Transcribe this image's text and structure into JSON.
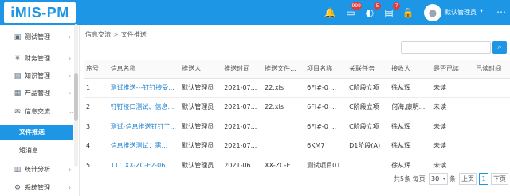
{
  "app": {
    "logo_text": "iMIS-PM"
  },
  "header": {
    "icons": [
      {
        "name": "bell-icon",
        "glyph": "🔔",
        "badge": ""
      },
      {
        "name": "message-icon",
        "glyph": "▭",
        "badge": "999"
      },
      {
        "name": "notice-icon",
        "glyph": "◐",
        "badge": "5"
      },
      {
        "name": "mail-icon",
        "glyph": "▤",
        "badge": "7"
      },
      {
        "name": "lock-icon",
        "glyph": "🔒",
        "badge": ""
      }
    ],
    "user_name": "默认管理员",
    "user_caret": "▾",
    "more_glyph": "⋯"
  },
  "sidebar": {
    "items": [
      {
        "label": "测试管理",
        "icon": "▣",
        "arrow": "›"
      },
      {
        "label": "财务管理",
        "icon": "¥",
        "arrow": "›"
      },
      {
        "label": "知识管理",
        "icon": "▤",
        "arrow": "›"
      },
      {
        "label": "产品管理",
        "icon": "▦",
        "arrow": "›"
      },
      {
        "label": "信息交流",
        "icon": "✉",
        "arrow": "⌄"
      },
      {
        "label": "统计分析",
        "icon": "▥",
        "arrow": "›"
      },
      {
        "label": "系统管理",
        "icon": "⚙",
        "arrow": "›"
      }
    ],
    "subitems": [
      {
        "label": "文件推送",
        "active": true
      },
      {
        "label": "短消息",
        "active": false
      }
    ]
  },
  "breadcrumb": {
    "parent": "信息交流",
    "separator": ">",
    "current": "文件推送"
  },
  "search": {
    "placeholder": "",
    "button_glyph": "⌕"
  },
  "table": {
    "headers": [
      "序号",
      "信息名称",
      "推送人",
      "推送时间",
      "推送文件...",
      "项目名称",
      "关联任务",
      "接收人",
      "是否已读",
      "已读时间"
    ],
    "rows": [
      [
        "1",
        "测试推送---钉钉接受...",
        "默认管理员",
        "2021-07...",
        "22.xls",
        "6FI#-0 ...",
        "C阶段立项",
        "徐从辉",
        "未读",
        ""
      ],
      [
        "2",
        "钉钉接口测试、信息...",
        "默认管理员",
        "2021-07...",
        "22.xls",
        "6FI#-0 ...",
        "C阶段立项",
        "何海,康明...",
        "未读",
        ""
      ],
      [
        "3",
        "测试-信息推送钉钉了...",
        "默认管理员",
        "2021-07...",
        "",
        "6FI#-0 ...",
        "C阶段立项",
        "徐从辉",
        "未读",
        ""
      ],
      [
        "4",
        "信息推送测试：需...",
        "默认管理员",
        "2021-07...",
        "",
        "6KM7",
        "D1阶段(A)",
        "徐从辉",
        "未读",
        ""
      ],
      [
        "5",
        "11：XX-ZC-E2-06...",
        "默认管理员",
        "2021-06...",
        "XX-ZC-E...",
        "测试项目01",
        "",
        "徐从辉",
        "未读",
        ""
      ]
    ]
  },
  "pager": {
    "total_text": "共5条 每页",
    "page_size": "30",
    "per_page_suffix": "条",
    "prev_label": "上页",
    "current_page": "1",
    "next_label": "下页"
  }
}
